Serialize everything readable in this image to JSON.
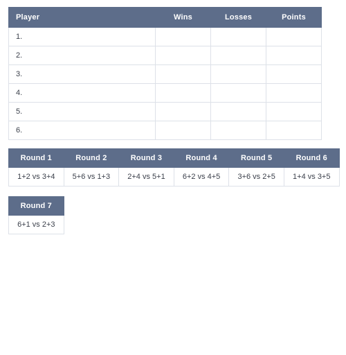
{
  "standings": {
    "columns": [
      {
        "key": "player",
        "label": "Player",
        "align": "left"
      },
      {
        "key": "wins",
        "label": "Wins",
        "align": "center"
      },
      {
        "key": "losses",
        "label": "Losses",
        "align": "center"
      },
      {
        "key": "points",
        "label": "Points",
        "align": "center"
      }
    ],
    "rows": [
      {
        "player": "1.",
        "wins": "",
        "losses": "",
        "points": ""
      },
      {
        "player": "2.",
        "wins": "",
        "losses": "",
        "points": ""
      },
      {
        "player": "3.",
        "wins": "",
        "losses": "",
        "points": ""
      },
      {
        "player": "4.",
        "wins": "",
        "losses": "",
        "points": ""
      },
      {
        "player": "5.",
        "wins": "",
        "losses": "",
        "points": ""
      },
      {
        "player": "6.",
        "wins": "",
        "losses": "",
        "points": ""
      }
    ]
  },
  "rounds_first_block": {
    "headers": [
      "Round 1",
      "Round 2",
      "Round 3",
      "Round 4",
      "Round 5",
      "Round 6"
    ],
    "matches": [
      "1+2 vs 3+4",
      "5+6 vs 1+3",
      "2+4 vs 5+1",
      "6+2 vs 4+5",
      "3+6 vs 2+5",
      "1+4 vs 3+5"
    ]
  },
  "rounds_second_block": {
    "headers": [
      "Round 7"
    ],
    "matches": [
      "6+1 vs 2+3"
    ]
  },
  "colors": {
    "header_background": "#5d6d8a",
    "header_text": "#ffffff",
    "cell_border": "#dde1e8",
    "cell_text": "#3a3f4a",
    "page_background": "#ffffff"
  }
}
